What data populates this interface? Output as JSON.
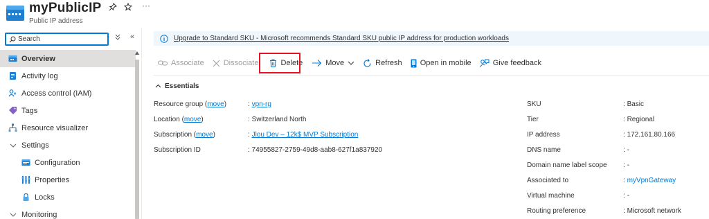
{
  "header": {
    "title": "myPublicIP",
    "subtitle": "Public IP address",
    "pin_icon": "pin-icon",
    "star_icon": "star-icon",
    "more_label": "···"
  },
  "sidebar": {
    "search_placeholder": "Search",
    "expand_label": "»",
    "collapse_label": "«",
    "items": [
      {
        "label": "Overview",
        "icon": "overview-icon",
        "active": true
      },
      {
        "label": "Activity log",
        "icon": "activity-log-icon"
      },
      {
        "label": "Access control (IAM)",
        "icon": "access-control-icon"
      },
      {
        "label": "Tags",
        "icon": "tag-icon"
      },
      {
        "label": "Resource visualizer",
        "icon": "resource-visualizer-icon"
      },
      {
        "label": "Settings",
        "icon": "chevron-down-icon",
        "group": true
      },
      {
        "label": "Configuration",
        "icon": "configuration-icon",
        "sub": true
      },
      {
        "label": "Properties",
        "icon": "properties-icon",
        "sub": true
      },
      {
        "label": "Locks",
        "icon": "lock-icon",
        "sub": true
      },
      {
        "label": "Monitoring",
        "icon": "chevron-down-icon",
        "group": true
      }
    ]
  },
  "banner": {
    "text": "Upgrade to Standard SKU - Microsoft recommends Standard SKU public IP address for production workloads",
    "icon": "info-icon"
  },
  "toolbar": {
    "associate": "Associate",
    "dissociate": "Dissociate",
    "delete": "Delete",
    "move": "Move",
    "refresh": "Refresh",
    "open_mobile": "Open in mobile",
    "feedback": "Give feedback"
  },
  "essentials": {
    "title": "Essentials",
    "left": [
      {
        "label": "Resource group",
        "link": "move",
        "value": "vpn-rg",
        "value_link": true
      },
      {
        "label": "Location",
        "link": "move",
        "value": "Switzerland North",
        "value_link": false
      },
      {
        "label": "Subscription",
        "link": "move",
        "value": "Jlou Dev – 12k$ MVP Subscription",
        "value_link": true
      },
      {
        "label": "Subscription ID",
        "link": "",
        "value": "74955827-2759-49d8-aab8-627f1a837920",
        "value_link": false
      }
    ],
    "right": [
      {
        "label": "SKU",
        "value": "Basic"
      },
      {
        "label": "Tier",
        "value": "Regional"
      },
      {
        "label": "IP address",
        "value": "172.161.80.166"
      },
      {
        "label": "DNS name",
        "value": "-"
      },
      {
        "label": "Domain name label scope",
        "value": "-"
      },
      {
        "label": "Associated to",
        "value": "myVpnGateway",
        "value_link": true
      },
      {
        "label": "Virtual machine",
        "value": "-"
      },
      {
        "label": "Routing preference",
        "value": "Microsoft network"
      }
    ]
  },
  "colors": {
    "accent": "#0078d4",
    "highlight_box": "#e81123",
    "banner_bg": "#eff6fc",
    "active_nav_bg": "#e1dfdd"
  }
}
